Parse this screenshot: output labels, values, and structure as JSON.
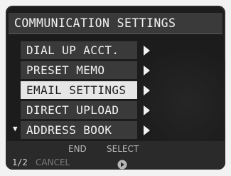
{
  "title": "COMMUNICATION SETTINGS",
  "menu": {
    "items": [
      {
        "label": "DIAL UP ACCT."
      },
      {
        "label": "PRESET MEMO"
      },
      {
        "label": "EMAIL SETTINGS"
      },
      {
        "label": "DIRECT UPLOAD"
      },
      {
        "label": "ADDRESS BOOK"
      }
    ],
    "selected_index": 2,
    "expanded_marker": "▼"
  },
  "footer": {
    "end_label": "END",
    "select_label": "SELECT",
    "cancel_label": "CANCEL",
    "page_indicator": "1/2"
  },
  "icons": {
    "item_arrow": "chevron-right-icon",
    "select": "select-button-icon"
  },
  "colors": {
    "screen_bg": "#1c1c1c",
    "item_bg": "#3a3a3a",
    "selected_bg": "#e6e6e6",
    "text": "#f2f2f2"
  }
}
